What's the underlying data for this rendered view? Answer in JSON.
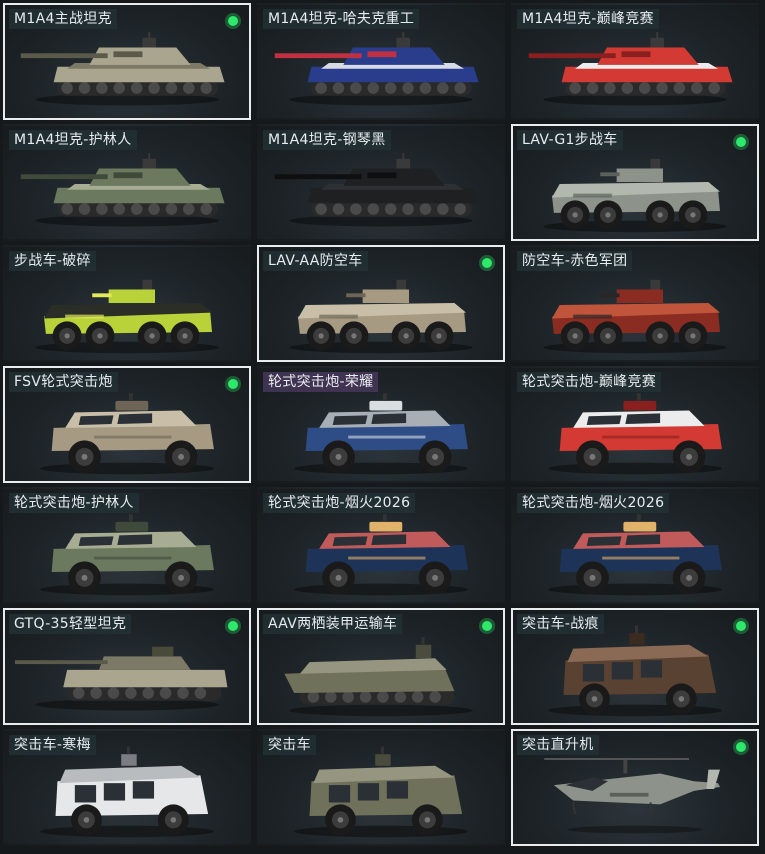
{
  "items": [
    {
      "label": "M1A4主战坦克",
      "owned": true,
      "type": "tank",
      "camo": "desert"
    },
    {
      "label": "M1A4坦克-哈夫克重工",
      "owned": false,
      "type": "tank",
      "camo": "navy"
    },
    {
      "label": "M1A4坦克-巅峰竞赛",
      "owned": false,
      "type": "tank",
      "camo": "race"
    },
    {
      "label": "M1A4坦克-护林人",
      "owned": false,
      "type": "tank",
      "camo": "forest"
    },
    {
      "label": "M1A4坦克-钢琴黑",
      "owned": false,
      "type": "tank",
      "camo": "black"
    },
    {
      "label": "LAV-G1步战车",
      "owned": true,
      "type": "ifv",
      "camo": "grey"
    },
    {
      "label": "步战车-破碎",
      "owned": false,
      "type": "ifv",
      "camo": "lime"
    },
    {
      "label": "LAV-AA防空车",
      "owned": true,
      "type": "ifv",
      "camo": "tan"
    },
    {
      "label": "防空车-赤色军团",
      "owned": false,
      "type": "ifv",
      "camo": "redcamo"
    },
    {
      "label": "FSV轮式突击炮",
      "owned": true,
      "type": "suv",
      "camo": "tan"
    },
    {
      "label": "轮式突击炮-荣耀",
      "owned": false,
      "type": "suv",
      "camo": "bluegrey",
      "purple": true
    },
    {
      "label": "轮式突击炮-巅峰竞赛",
      "owned": false,
      "type": "suv",
      "camo": "race"
    },
    {
      "label": "轮式突击炮-护林人",
      "owned": false,
      "type": "suv",
      "camo": "forest"
    },
    {
      "label": "轮式突击炮-烟火2026",
      "owned": false,
      "type": "suv",
      "camo": "firework"
    },
    {
      "label": "轮式突击炮-烟火2026",
      "owned": false,
      "type": "suv",
      "camo": "firework"
    },
    {
      "label": "GTQ-35轻型坦克",
      "owned": true,
      "type": "ltank",
      "camo": "desert"
    },
    {
      "label": "AAV两栖装甲运输车",
      "owned": true,
      "type": "aav",
      "camo": "olive"
    },
    {
      "label": "突击车-战痕",
      "owned": true,
      "type": "mrap",
      "camo": "brown"
    },
    {
      "label": "突击车-寒梅",
      "owned": false,
      "type": "mrap",
      "camo": "white"
    },
    {
      "label": "突击车",
      "owned": false,
      "type": "mrap",
      "camo": "olive"
    },
    {
      "label": "突击直升机",
      "owned": true,
      "type": "heli",
      "camo": "grey"
    }
  ],
  "colors": {
    "owned_border": "#e9ecee",
    "owned_dot": "#2ee86c",
    "label_bg": "#223034",
    "background": "#15191c"
  },
  "camo_colors": {
    "desert": [
      "#a9a58f",
      "#7c7a66",
      "#5b5a4a"
    ],
    "navy": [
      "#2a3d8c",
      "#d7dbe6",
      "#c03040"
    ],
    "race": [
      "#d33a33",
      "#ececec",
      "#8a1f1f"
    ],
    "forest": [
      "#6b7a5f",
      "#a6ad92",
      "#3f4a3a"
    ],
    "black": [
      "#1e2022",
      "#2e3134",
      "#0e0f10"
    ],
    "grey": [
      "#8d938b",
      "#b3b8ae",
      "#5c625b"
    ],
    "lime": [
      "#b9d23a",
      "#2a2e26",
      "#e2ea5a"
    ],
    "tan": [
      "#a69a83",
      "#c9bfa8",
      "#6e6556"
    ],
    "redcamo": [
      "#8a2c22",
      "#c0553b",
      "#2a2626"
    ],
    "bluegrey": [
      "#2e4c86",
      "#a7aeb6",
      "#d8dde2"
    ],
    "firework": [
      "#1e3358",
      "#c15a5a",
      "#e0b26a"
    ],
    "olive": [
      "#6f715b",
      "#969680",
      "#4a4c3d"
    ],
    "brown": [
      "#5a4232",
      "#8a6a54",
      "#3a2a20"
    ],
    "white": [
      "#e6e7e8",
      "#b8bcbf",
      "#7a7e82"
    ]
  }
}
